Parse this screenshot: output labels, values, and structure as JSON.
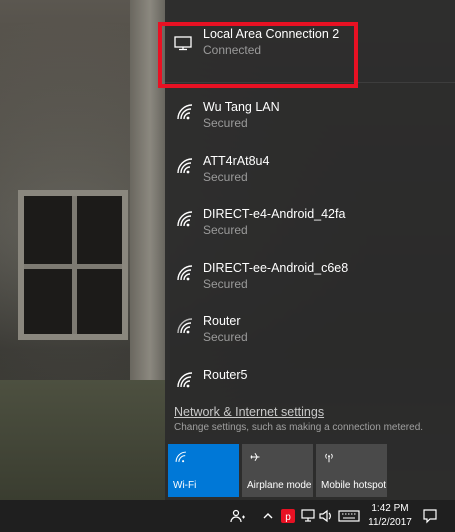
{
  "networks": [
    {
      "name": "Local Area Connection 2",
      "status": "Connected",
      "type": "ethernet"
    },
    {
      "name": "Wu Tang LAN",
      "status": "Secured",
      "type": "wifi"
    },
    {
      "name": "ATT4rAt8u4",
      "status": "Secured",
      "type": "wifi"
    },
    {
      "name": "DIRECT-e4-Android_42fa",
      "status": "Secured",
      "type": "wifi"
    },
    {
      "name": "DIRECT-ee-Android_c6e8",
      "status": "Secured",
      "type": "wifi"
    },
    {
      "name": "Router",
      "status": "Secured",
      "type": "wifi"
    },
    {
      "name": "Router5",
      "status": "",
      "type": "wifi"
    }
  ],
  "settings": {
    "link": "Network & Internet settings",
    "subtitle": "Change settings, such as making a connection metered."
  },
  "tiles": [
    {
      "label": "Wi-Fi",
      "active": true,
      "icon": "wifi-icon"
    },
    {
      "label": "Airplane mode",
      "active": false,
      "icon": "airplane-icon"
    },
    {
      "label": "Mobile hotspot",
      "active": false,
      "icon": "hotspot-icon"
    }
  ],
  "taskbar": {
    "time": "1:42 PM",
    "date": "11/2/2017",
    "icons": [
      "people-icon",
      "chevron-up-icon",
      "app-red-icon",
      "network-icon",
      "volume-icon",
      "keyboard-icon",
      "action-center-icon"
    ]
  },
  "colors": {
    "accent": "#0078d7",
    "highlight": "#e81123"
  }
}
